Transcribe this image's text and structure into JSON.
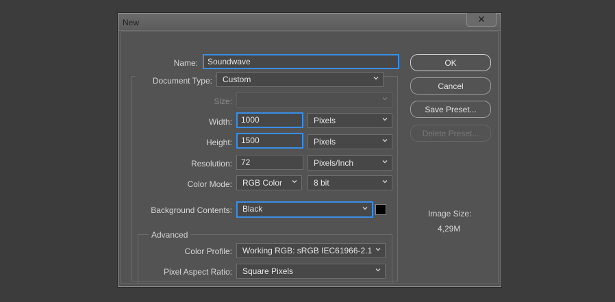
{
  "dialog": {
    "title": "New",
    "close_glyph": "✕"
  },
  "form": {
    "name_label": "Name:",
    "name_value": "Soundwave",
    "document_type_label": "Document Type:",
    "document_type_value": "Custom",
    "size_label": "Size:",
    "size_value": "",
    "width_label": "Width:",
    "width_value": "1000",
    "width_unit": "Pixels",
    "height_label": "Height:",
    "height_value": "1500",
    "height_unit": "Pixels",
    "resolution_label": "Resolution:",
    "resolution_value": "72",
    "resolution_unit": "Pixels/Inch",
    "color_mode_label": "Color Mode:",
    "color_mode_value": "RGB Color",
    "bit_depth_value": "8 bit",
    "background_label": "Background Contents:",
    "background_value": "Black",
    "background_swatch_color": "#000000"
  },
  "advanced": {
    "legend": "Advanced",
    "color_profile_label": "Color Profile:",
    "color_profile_value": "Working RGB:  sRGB IEC61966-2.1",
    "pixel_aspect_label": "Pixel Aspect Ratio:",
    "pixel_aspect_value": "Square Pixels"
  },
  "buttons": {
    "ok": "OK",
    "cancel": "Cancel",
    "save_preset": "Save Preset...",
    "delete_preset": "Delete Preset..."
  },
  "image_size": {
    "label": "Image Size:",
    "value": "4,29M"
  },
  "theme": {
    "focus_color": "#3a8ee6",
    "dialog_bg": "#535353",
    "page_bg": "#3c3c3c"
  }
}
